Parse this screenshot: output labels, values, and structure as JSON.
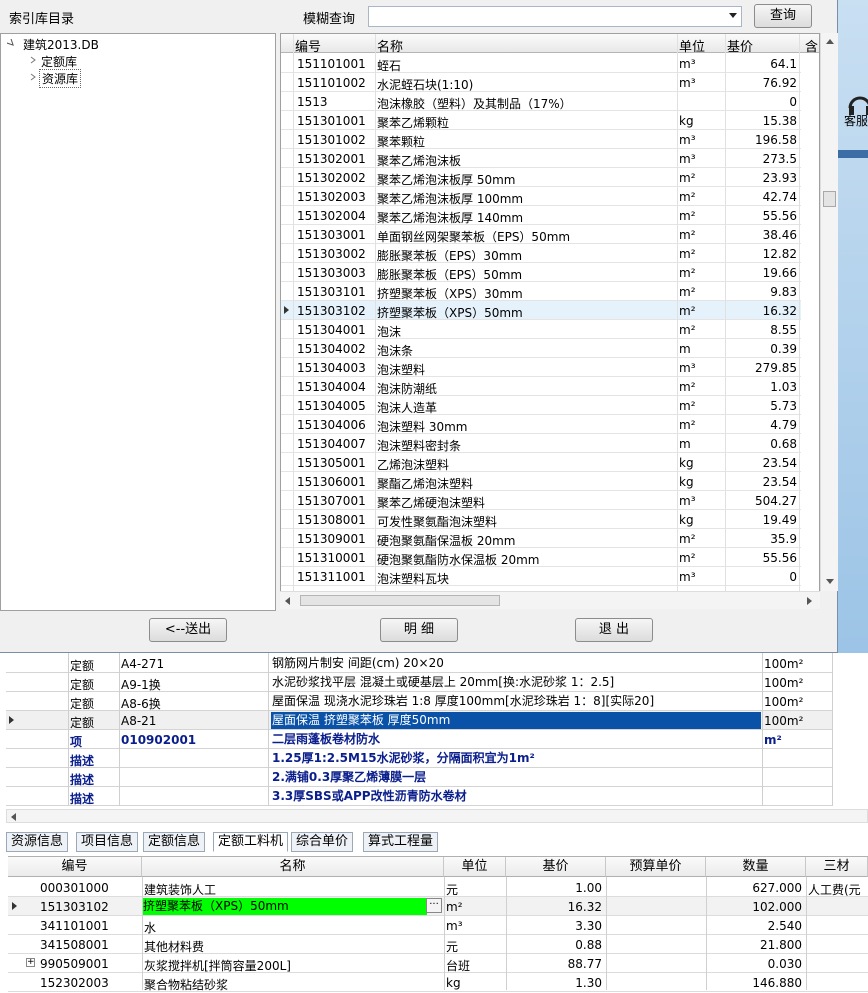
{
  "dialog": {
    "tree_title": "索引库目录",
    "search_label": "模糊查询",
    "search_value": "",
    "query_button": "查询",
    "tree": {
      "root": "建筑2013.DB",
      "children": [
        "定额库",
        "资源库"
      ]
    },
    "columns": [
      "编号",
      "名称",
      "单位",
      "基价",
      "含"
    ],
    "rows": [
      {
        "code": "151101001",
        "name": "蛭石",
        "unit": "m³",
        "price": "64.1"
      },
      {
        "code": "151101002",
        "name": "水泥蛭石块(1:10)",
        "unit": "m³",
        "price": "76.92"
      },
      {
        "code": "1513",
        "name": "泡沫橡胶（塑料）及其制品（17%）",
        "unit": "",
        "price": "0"
      },
      {
        "code": "151301001",
        "name": "聚苯乙烯颗粒",
        "unit": "kg",
        "price": "15.38"
      },
      {
        "code": "151301002",
        "name": "聚苯颗粒",
        "unit": "m³",
        "price": "196.58"
      },
      {
        "code": "151302001",
        "name": "聚苯乙烯泡沫板",
        "unit": "m³",
        "price": "273.5"
      },
      {
        "code": "151302002",
        "name": "聚苯乙烯泡沫板厚 50mm",
        "unit": "m²",
        "price": "23.93"
      },
      {
        "code": "151302003",
        "name": "聚苯乙烯泡沫板厚 100mm",
        "unit": "m²",
        "price": "42.74"
      },
      {
        "code": "151302004",
        "name": "聚苯乙烯泡沫板厚 140mm",
        "unit": "m²",
        "price": "55.56"
      },
      {
        "code": "151303001",
        "name": "单面钢丝网架聚苯板（EPS）50mm",
        "unit": "m²",
        "price": "38.46"
      },
      {
        "code": "151303002",
        "name": "膨胀聚苯板（EPS）30mm",
        "unit": "m²",
        "price": "12.82"
      },
      {
        "code": "151303003",
        "name": "膨胀聚苯板（EPS）50mm",
        "unit": "m²",
        "price": "19.66"
      },
      {
        "code": "151303101",
        "name": "挤塑聚苯板（XPS）30mm",
        "unit": "m²",
        "price": "9.83"
      },
      {
        "code": "151303102",
        "name": "挤塑聚苯板（XPS）50mm",
        "unit": "m²",
        "price": "16.32"
      },
      {
        "code": "151304001",
        "name": "泡沫",
        "unit": "m²",
        "price": "8.55"
      },
      {
        "code": "151304002",
        "name": "泡沫条",
        "unit": "m",
        "price": "0.39"
      },
      {
        "code": "151304003",
        "name": "泡沫塑料",
        "unit": "m³",
        "price": "279.85"
      },
      {
        "code": "151304004",
        "name": "泡沫防潮纸",
        "unit": "m²",
        "price": "1.03"
      },
      {
        "code": "151304005",
        "name": "泡沫人造革",
        "unit": "m²",
        "price": "5.73"
      },
      {
        "code": "151304006",
        "name": "泡沫塑料 30mm",
        "unit": "m²",
        "price": "4.79"
      },
      {
        "code": "151304007",
        "name": "泡沫塑料密封条",
        "unit": "m",
        "price": "0.68"
      },
      {
        "code": "151305001",
        "name": "乙烯泡沫塑料",
        "unit": "kg",
        "price": "23.54"
      },
      {
        "code": "151306001",
        "name": "聚酯乙烯泡沫塑料",
        "unit": "kg",
        "price": "23.54"
      },
      {
        "code": "151307001",
        "name": "聚苯乙烯硬泡沫塑料",
        "unit": "m³",
        "price": "504.27"
      },
      {
        "code": "151308001",
        "name": "可发性聚氨酯泡沫塑料",
        "unit": "kg",
        "price": "19.49"
      },
      {
        "code": "151309001",
        "name": "硬泡聚氨酯保温板 20mm",
        "unit": "m²",
        "price": "35.9"
      },
      {
        "code": "151310001",
        "name": "硬泡聚氨酯防水保温板 20mm",
        "unit": "m²",
        "price": "55.56"
      },
      {
        "code": "151311001",
        "name": "泡沫塑料瓦块",
        "unit": "m³",
        "price": "0"
      }
    ],
    "btn_send": "<--送出",
    "btn_detail": "明 细",
    "btn_exit": "退 出"
  },
  "desktop_label": "客服",
  "quota": {
    "rows": [
      {
        "type": "定额",
        "code": "A4-271",
        "name": "钢筋网片制安 间距(cm) 20×20",
        "unit": "100m²"
      },
      {
        "type": "定额",
        "code": "A9-1换",
        "name": "水泥砂浆找平层 混凝土或硬基层上 20mm[换:水泥砂浆 1：2.5]",
        "unit": "100m²"
      },
      {
        "type": "定额",
        "code": "A8-6换",
        "name": "屋面保温 现浇水泥珍珠岩 1:8 厚度100mm[水泥珍珠岩 1：8][实际20]",
        "unit": "100m²"
      },
      {
        "type": "定额",
        "code": "A8-21",
        "name": "屋面保温 挤塑聚苯板 厚度50mm",
        "unit": "100m²"
      },
      {
        "type": "项",
        "code": "010902001",
        "name": "二层雨蓬板卷材防水",
        "unit": "m²"
      },
      {
        "type": "描述",
        "code": "",
        "name": "1.25厚1:2.5M15水泥砂浆，分隔面积宜为1m²",
        "unit": ""
      },
      {
        "type": "描述",
        "code": "",
        "name": "2.满铺0.3厚聚乙烯薄膜一层",
        "unit": ""
      },
      {
        "type": "描述",
        "code": "",
        "name": "3.3厚SBS或APP改性沥青防水卷材",
        "unit": ""
      }
    ]
  },
  "tabs": [
    "资源信息",
    "项目信息",
    "定额信息",
    "定额工料机",
    "综合单价",
    "算式工程量"
  ],
  "materials": {
    "columns": [
      "编号",
      "名称",
      "单位",
      "基价",
      "预算单价",
      "数量",
      "三材"
    ],
    "rows": [
      {
        "code": "000301000",
        "name": "建筑装饰人工",
        "unit": "元",
        "price": "1.00",
        "budget": "",
        "qty": "627.000",
        "extra": "人工费(元"
      },
      {
        "code": "151303102",
        "name": "挤塑聚苯板（XPS）50mm",
        "unit": "m²",
        "price": "16.32",
        "budget": "",
        "qty": "102.000",
        "extra": ""
      },
      {
        "code": "341101001",
        "name": "水",
        "unit": "m³",
        "price": "3.30",
        "budget": "",
        "qty": "2.540",
        "extra": ""
      },
      {
        "code": "341508001",
        "name": "其他材料费",
        "unit": "元",
        "price": "0.88",
        "budget": "",
        "qty": "21.800",
        "extra": ""
      },
      {
        "code": "990509001",
        "name": "灰浆搅拌机[拌筒容量200L]",
        "unit": "台班",
        "price": "88.77",
        "budget": "",
        "qty": "0.030",
        "extra": ""
      },
      {
        "code": "152302003",
        "name": "聚合物粘结砂浆",
        "unit": "kg",
        "price": "1.30",
        "budget": "",
        "qty": "146.880",
        "extra": ""
      }
    ]
  },
  "colors": {
    "selection": "#0a52a8",
    "highlight": "#00ff00",
    "desc": "#0a1e8c"
  }
}
